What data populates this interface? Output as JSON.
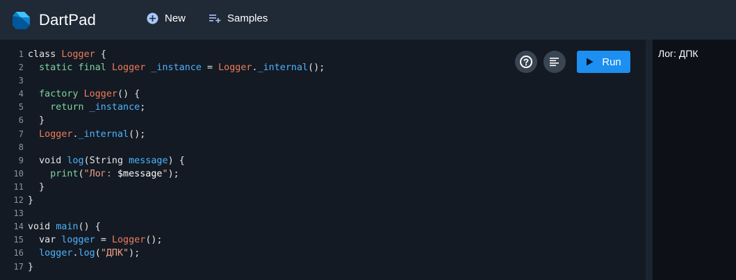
{
  "header": {
    "app_title": "DartPad",
    "new_label": "New",
    "samples_label": "Samples"
  },
  "editor": {
    "run_label": "Run",
    "help_icon": "help-circle-icon",
    "format_icon": "format-align-icon",
    "lines": [
      {
        "n": "1",
        "code": "class Logger {"
      },
      {
        "n": "2",
        "code": "  static final Logger _instance = Logger._internal();"
      },
      {
        "n": "3",
        "code": ""
      },
      {
        "n": "4",
        "code": "  factory Logger() {"
      },
      {
        "n": "5",
        "code": "    return _instance;"
      },
      {
        "n": "6",
        "code": "  }"
      },
      {
        "n": "7",
        "code": "  Logger._internal();"
      },
      {
        "n": "8",
        "code": ""
      },
      {
        "n": "9",
        "code": "  void log(String message) {"
      },
      {
        "n": "10",
        "code": "    print(\"Лог: $message\");"
      },
      {
        "n": "11",
        "code": "  }"
      },
      {
        "n": "12",
        "code": "}"
      },
      {
        "n": "13",
        "code": ""
      },
      {
        "n": "14",
        "code": "void main() {"
      },
      {
        "n": "15",
        "code": "  var logger = Logger();"
      },
      {
        "n": "16",
        "code": "  logger.log(\"ДПК\");"
      },
      {
        "n": "17",
        "code": "}"
      }
    ]
  },
  "output": {
    "text": "Лог: ДПК"
  },
  "colors": {
    "header_bg": "#1f2a36",
    "editor_bg": "#131a23",
    "run_button": "#1c8ff0"
  }
}
